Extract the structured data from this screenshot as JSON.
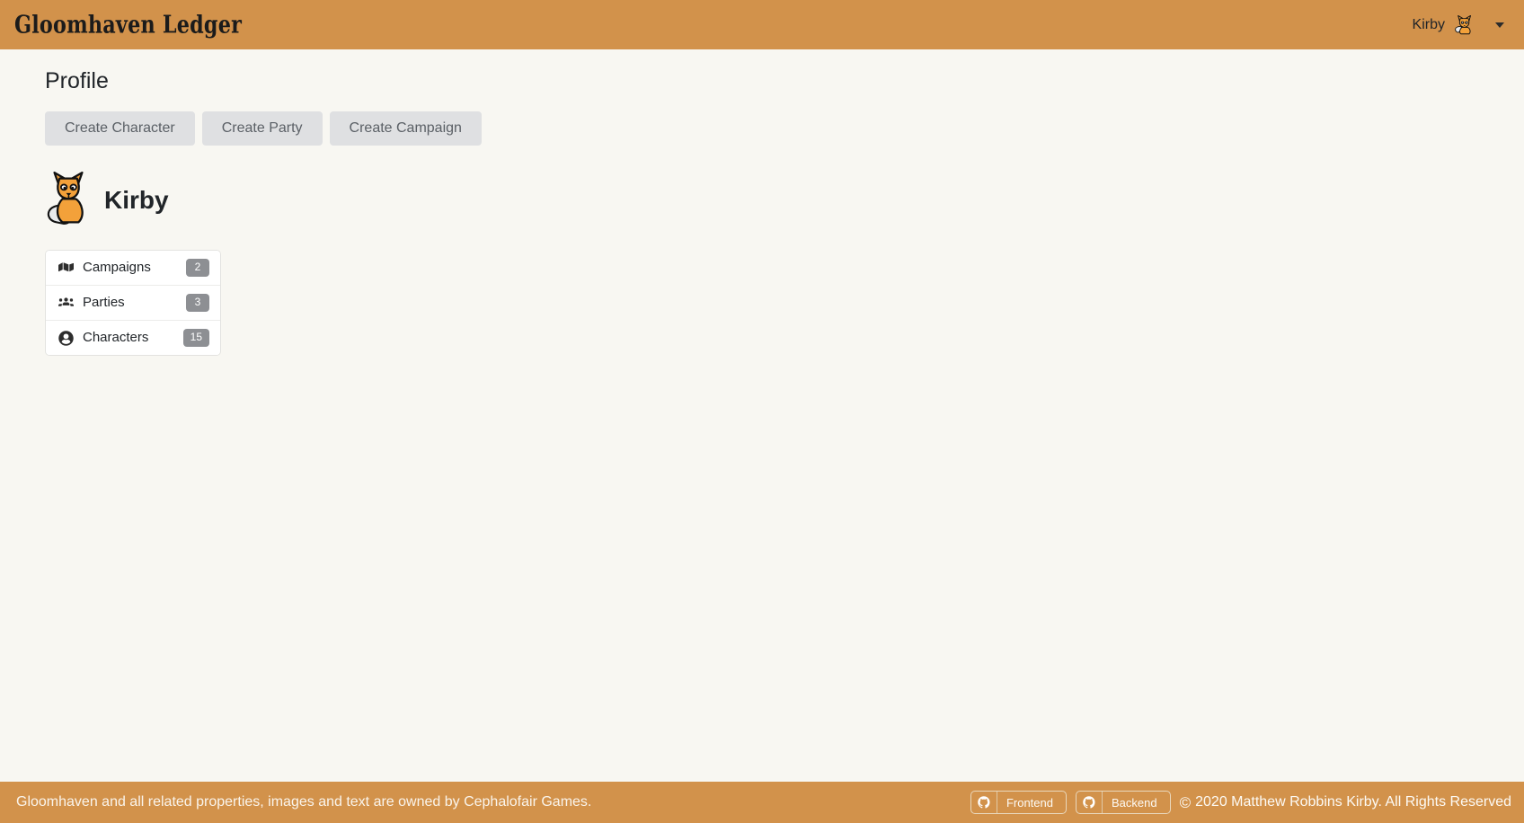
{
  "navbar": {
    "brand": "Gloomhaven Ledger",
    "user_name": "Kirby",
    "avatar_icon": "fox-avatar-icon",
    "caret_icon": "chevron-down-icon",
    "bg_color": "#d2924b"
  },
  "main": {
    "page_title": "Profile",
    "buttons": [
      {
        "label": "Create Character",
        "name": "create-character-button"
      },
      {
        "label": "Create Party",
        "name": "create-party-button"
      },
      {
        "label": "Create Campaign",
        "name": "create-campaign-button"
      }
    ],
    "profile": {
      "name": "Kirby",
      "avatar_icon": "fox-avatar-icon"
    },
    "list": [
      {
        "label": "Campaigns",
        "count": "2",
        "icon": "map-icon"
      },
      {
        "label": "Parties",
        "count": "3",
        "icon": "users-icon"
      },
      {
        "label": "Characters",
        "count": "15",
        "icon": "user-circle-icon"
      }
    ]
  },
  "footer": {
    "attribution": "Gloomhaven and all related properties, images and text are owned by Cephalofair Games.",
    "badges": [
      {
        "label": "Frontend",
        "icon": "github-icon"
      },
      {
        "label": "Backend",
        "icon": "github-icon"
      }
    ],
    "copyright_mark": "©",
    "copyright": "2020 Matthew Robbins Kirby. All Rights Reserved",
    "bg_color": "#d2924b"
  },
  "colors": {
    "accent": "#d2924b",
    "page_bg": "#f8f7f2",
    "button_bg": "#dfe0e2",
    "badge_bg": "#8d8f93"
  }
}
